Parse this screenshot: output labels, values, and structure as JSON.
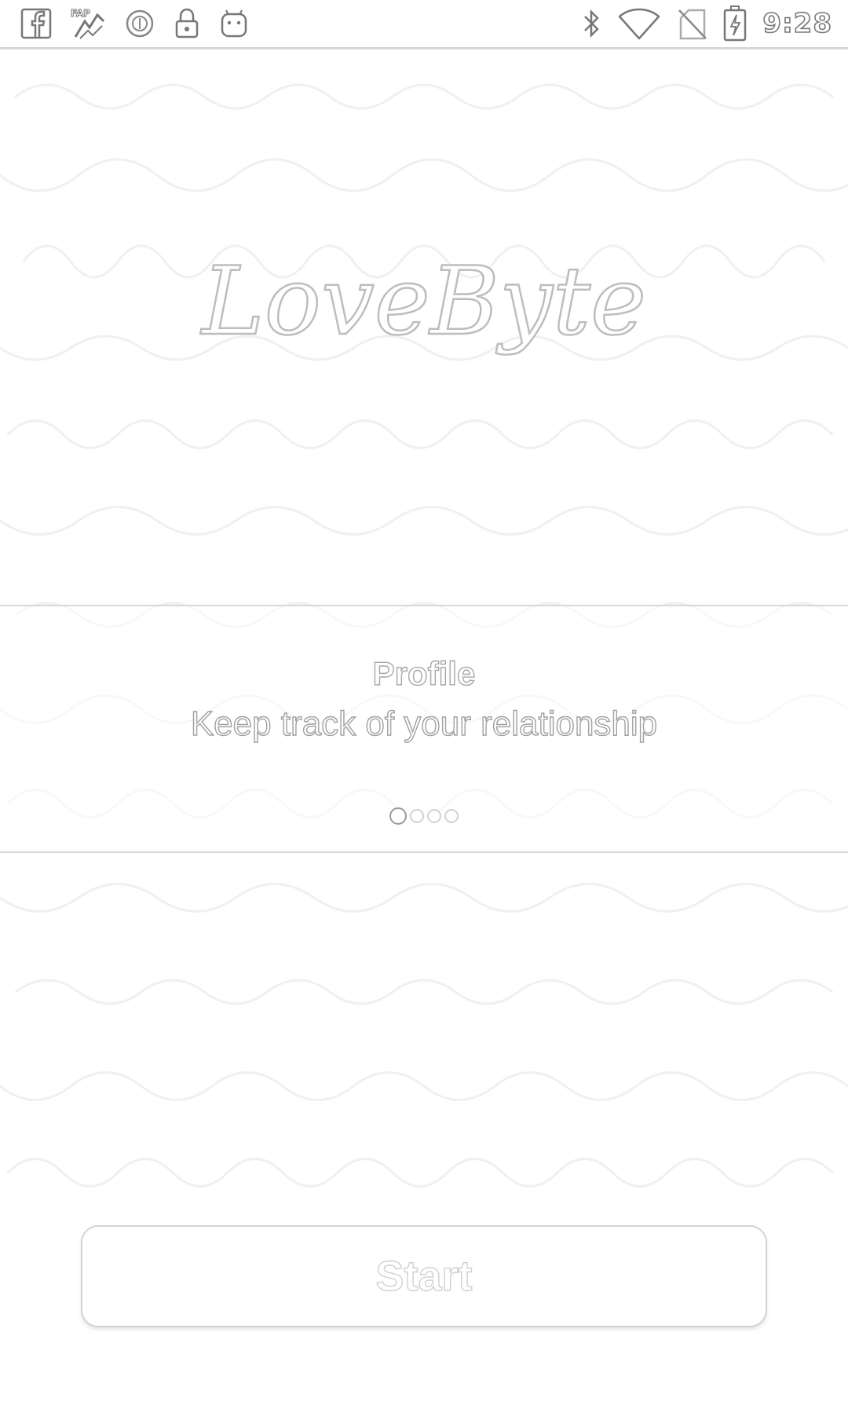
{
  "status_bar": {
    "left_icons": [
      "facebook-icon",
      "fap-icon",
      "data-saver-icon",
      "lock-icon",
      "android-icon"
    ],
    "right_icons": [
      "bluetooth-icon",
      "wifi-icon",
      "no-sim-icon",
      "battery-charging-icon"
    ],
    "time": "9:28"
  },
  "app": {
    "logo_text": "LoveByte"
  },
  "onboarding": {
    "title": "Profile",
    "subtitle": "Keep track of your relationship",
    "pages_total": 4,
    "current_page": 1
  },
  "start_button": {
    "label": "Start"
  },
  "colors": {
    "background": "#ffffff",
    "outline": "#c8c8c8",
    "divider": "#d9d9d9"
  }
}
